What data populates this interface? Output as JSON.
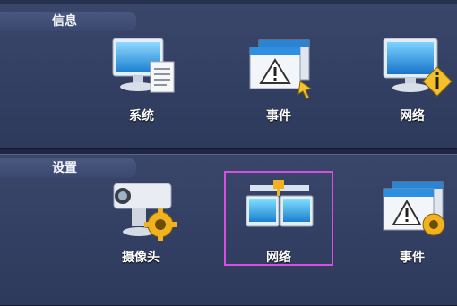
{
  "sections": [
    {
      "title": "信息",
      "items": [
        {
          "label": "系统",
          "icon": "monitor-document-icon"
        },
        {
          "label": "事件",
          "icon": "warning-window-icon"
        },
        {
          "label": "网络",
          "icon": "monitor-info-icon"
        }
      ]
    },
    {
      "title": "设置",
      "items": [
        {
          "label": "摄像头",
          "icon": "camera-gear-icon"
        },
        {
          "label": "网络",
          "icon": "network-monitors-icon"
        },
        {
          "label": "事件",
          "icon": "warning-window-gear-icon"
        }
      ]
    }
  ],
  "selection": {
    "section": "设置",
    "item": "网络"
  },
  "colors": {
    "background": "#1d2643",
    "panel": "#34405f",
    "selection": "#d84fe0",
    "text": "#ffffff"
  }
}
